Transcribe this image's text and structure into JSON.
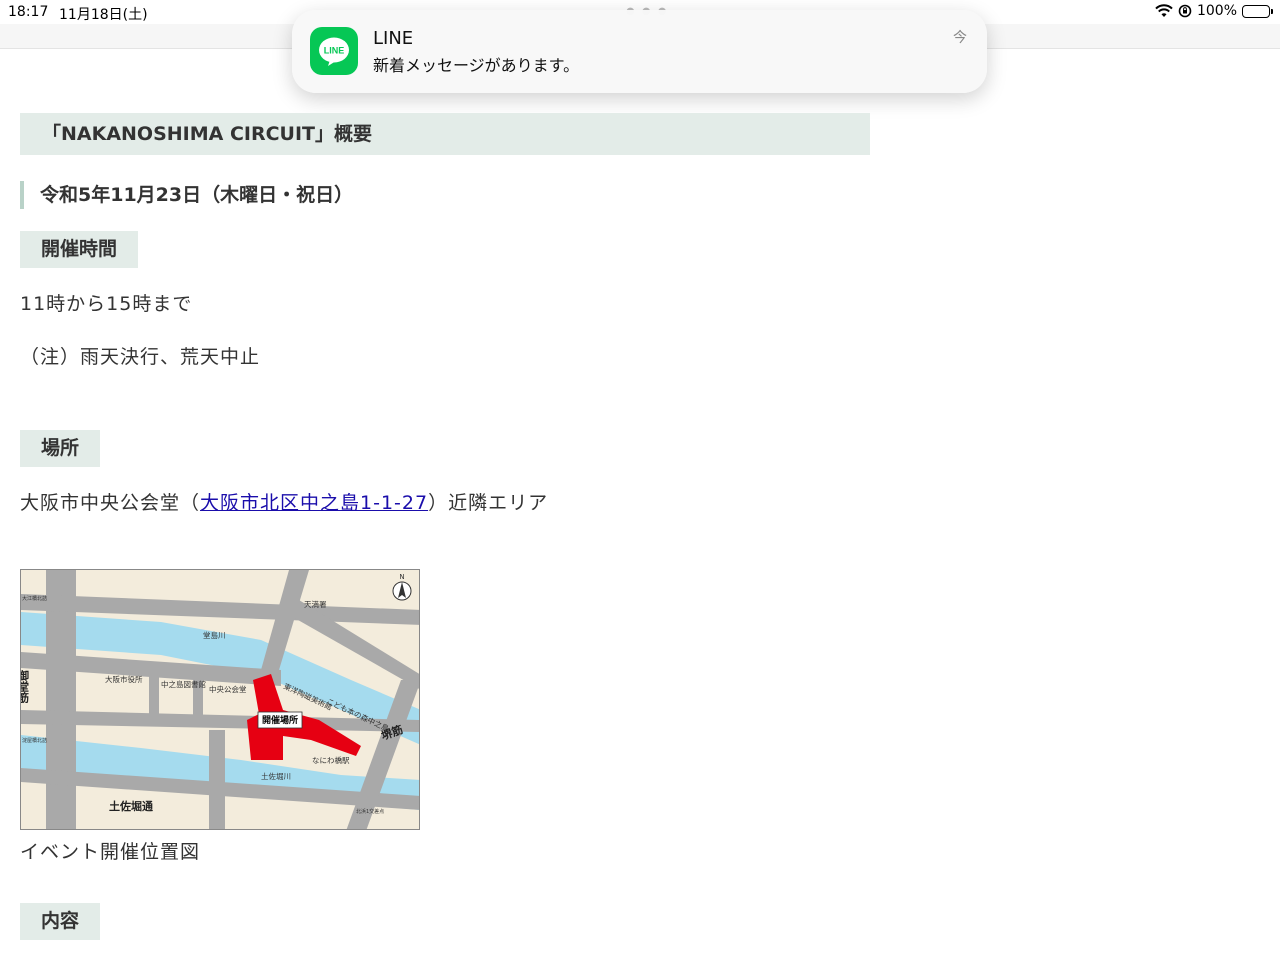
{
  "status_bar": {
    "time": "18:17",
    "date": "11月18日(土)",
    "battery": "100%"
  },
  "notification": {
    "app_name": "LINE",
    "icon_text": "LINE",
    "message": "新着メッセージがあります。",
    "time": "今"
  },
  "content": {
    "section_title": "「NAKANOSHIMA CIRCUIT」概要",
    "event_date": "令和5年11月23日（木曜日・祝日）",
    "time_label": "開催時間",
    "time_value": "11時から15時まで",
    "note": "（注）雨天決行、荒天中止",
    "place_label": "場所",
    "place_prefix": "大阪市中央公会堂（",
    "place_link": "大阪市北区中之島1-1-27",
    "place_suffix": "）近隣エリア",
    "map_caption": "イベント開催位置図",
    "contents_label": "内容"
  },
  "map": {
    "north": "N",
    "venue": "開催場所",
    "labels": {
      "tenma": "天満署",
      "dojima_river": "堂島川",
      "mido": "御堂筋",
      "osaka_city_hall": "大阪市役所",
      "library": "中之島図書館",
      "public_hall": "中央公会堂",
      "ceramics": "東洋陶磁美術館",
      "kodomo": "こども本の森中之島",
      "sakai": "堺筋",
      "naniwabashi": "なにわ橋駅",
      "tosabori_river": "土佐堀川",
      "tosabori_st": "土佐堀通",
      "oebashi": "大江橋北詰",
      "yodoyabashi": "淀屋橋北詰",
      "kitahama": "北浜1交差点"
    }
  }
}
